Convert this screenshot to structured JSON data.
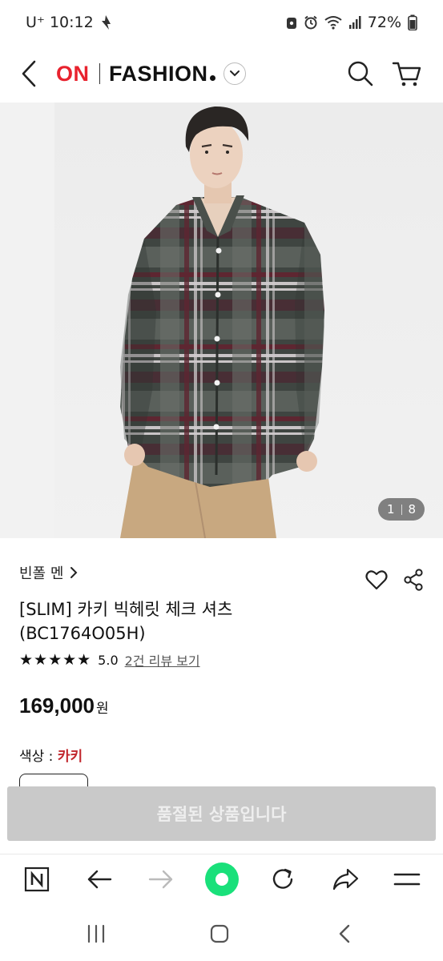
{
  "status_bar": {
    "carrier": "U⁺",
    "time": "10:12",
    "battery": "72%"
  },
  "header": {
    "brand_on": "ON",
    "brand_fashion": "FASHION"
  },
  "gallery": {
    "current": "1",
    "total": "8"
  },
  "product": {
    "brand_name": "빈폴 멘",
    "title_line1": "[SLIM] 카키 빅헤릿 체크 셔츠",
    "title_line2": "(BC1764O05H)",
    "rating_stars": "★★★★★",
    "rating_value": "5.0",
    "review_link": "2건 리뷰 보기",
    "price": "169,000",
    "price_unit": "원",
    "color_label": "색상 : ",
    "color_value": "카키"
  },
  "sold_out_label": "품절된 상품입니다",
  "colors": {
    "brand_red": "#e8222e",
    "color_value_red": "#c1272d",
    "sold_out_bg": "#c9c9c9",
    "browser_green": "#19e07a"
  },
  "icons": {
    "header": [
      "back-arrow-icon",
      "chevron-down-icon",
      "search-icon",
      "cart-icon"
    ],
    "info": [
      "chevron-right-icon",
      "heart-icon",
      "share-icon"
    ],
    "browser": [
      "naver-n-icon",
      "back-arrow-icon",
      "forward-arrow-icon",
      "home-green-dot-icon",
      "refresh-icon",
      "share-forward-icon",
      "menu-icon"
    ],
    "system_nav": [
      "recent-apps-icon",
      "home-icon",
      "back-icon"
    ]
  }
}
